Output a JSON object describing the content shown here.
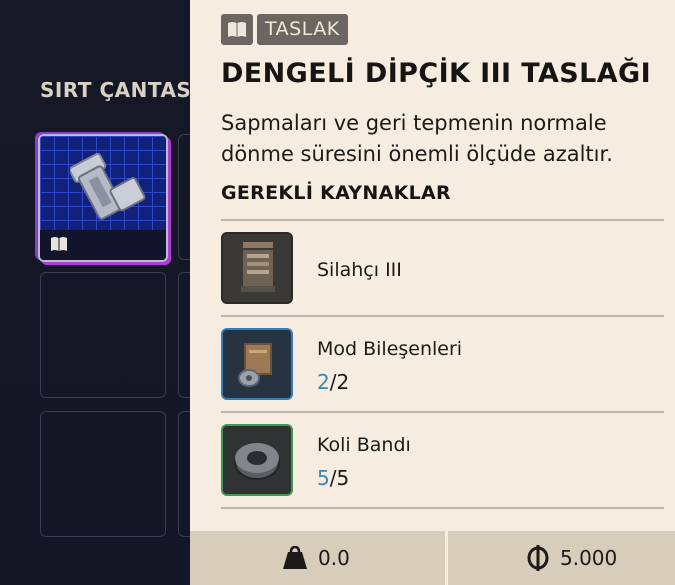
{
  "inventory": {
    "title": "SIRT ÇANTASI"
  },
  "tooltip": {
    "tag": "TASLAK",
    "title": "DENGELİ DİPÇİK III TASLAĞI",
    "description": "Sapmaları ve geri tepmenin normale dönme süresini önemli ölçüde azaltır.",
    "requirements_heading": "GEREKLİ KAYNAKLAR",
    "resources": [
      {
        "name": "Silahçı III",
        "have": "",
        "need": "",
        "border": "#2a2a2a"
      },
      {
        "name": "Mod Bileşenleri",
        "have": "2",
        "need": "/2",
        "border": "#2f7fb8"
      },
      {
        "name": "Koli Bandı",
        "have": "5",
        "need": "/5",
        "border": "#3e9a52"
      }
    ]
  },
  "footer": {
    "weight": "0.0",
    "price": "5.000"
  },
  "icons": {
    "tag": "book-icon",
    "weight": "weight-icon",
    "price": "coin-icon"
  }
}
